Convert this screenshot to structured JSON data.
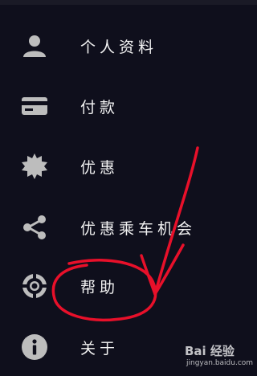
{
  "menu": {
    "items": [
      {
        "label": "个人资料",
        "icon": "person-icon"
      },
      {
        "label": "付款",
        "icon": "credit-card-icon"
      },
      {
        "label": "优惠",
        "icon": "promo-badge-icon"
      },
      {
        "label": "优惠乘车机会",
        "icon": "share-icon"
      },
      {
        "label": "帮助",
        "icon": "lifebuoy-icon"
      },
      {
        "label": "关于",
        "icon": "info-icon"
      }
    ]
  },
  "colors": {
    "background": "#0f0f1c",
    "icon": "#bdbdbd",
    "label": "#f2f2f2",
    "annotation": "#e8102a"
  },
  "watermark": {
    "logo": "Bai 经验",
    "url": "jingyan.baidu.com"
  }
}
